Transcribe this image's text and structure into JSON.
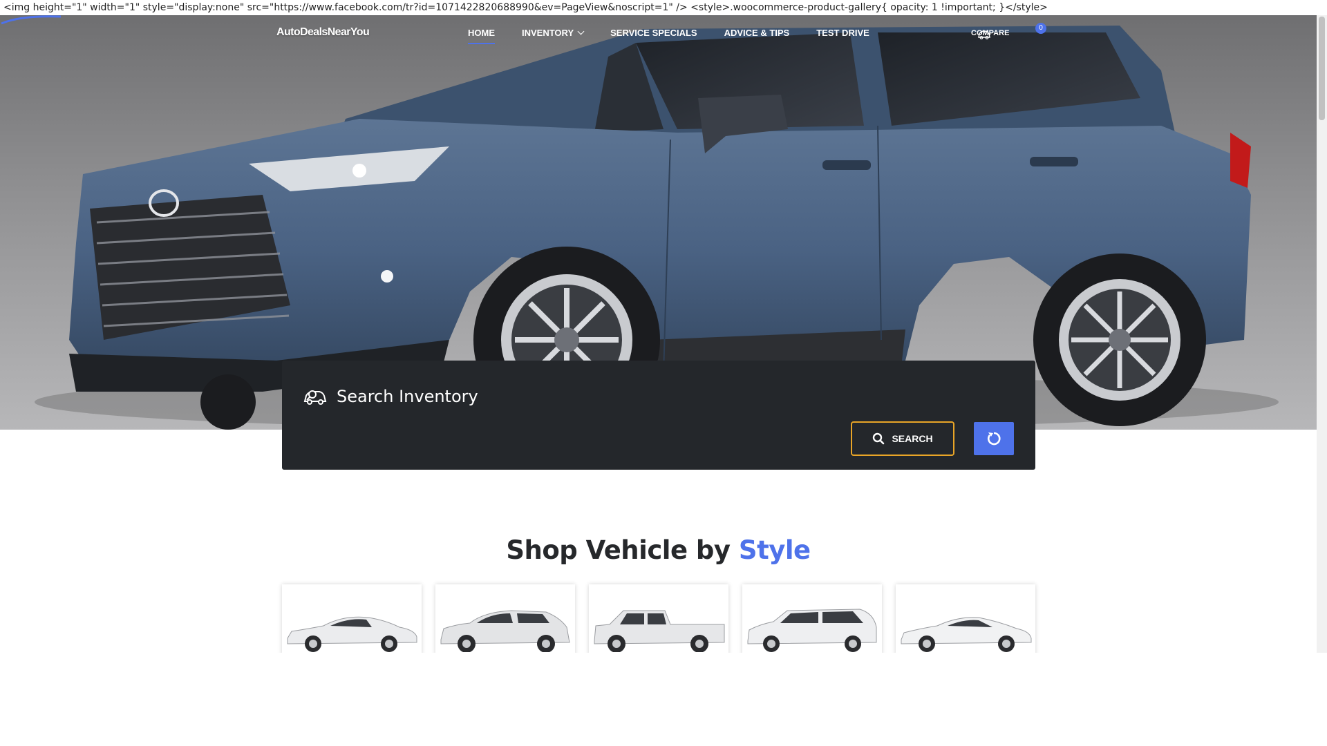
{
  "raw_text": "<img height=\"1\" width=\"1\" style=\"display:none\" src=\"https://www.facebook.com/tr?id=1071422820688990&ev=PageView&noscript=1\" /> <style>.woocommerce-product-gallery{ opacity: 1 !important; }</style>",
  "header": {
    "logo": "AutoDealsNearYou",
    "nav": [
      {
        "label": "HOME",
        "active": true
      },
      {
        "label": "INVENTORY",
        "has_dropdown": true
      },
      {
        "label": "SERVICE SPECIALS"
      },
      {
        "label": "ADVICE & TIPS"
      },
      {
        "label": "TEST DRIVE"
      }
    ],
    "compare": {
      "label": "COMPARE",
      "count": "0",
      "icon": "car-outline-icon"
    }
  },
  "search": {
    "title": "Search Inventory",
    "title_icon": "car-search-icon",
    "search_button": "SEARCH",
    "search_icon": "search-icon",
    "reset_icon": "reset-icon"
  },
  "section": {
    "title_prefix": "Shop Vehicle by ",
    "title_accent": "Style",
    "styles": [
      "sedan-image",
      "suv-image",
      "truck-image",
      "minivan-image",
      "coupe-image"
    ]
  },
  "colors": {
    "accent": "#4e72ea",
    "search_border": "#e9a527",
    "panel_bg": "#24272b",
    "title": "#26282b"
  }
}
